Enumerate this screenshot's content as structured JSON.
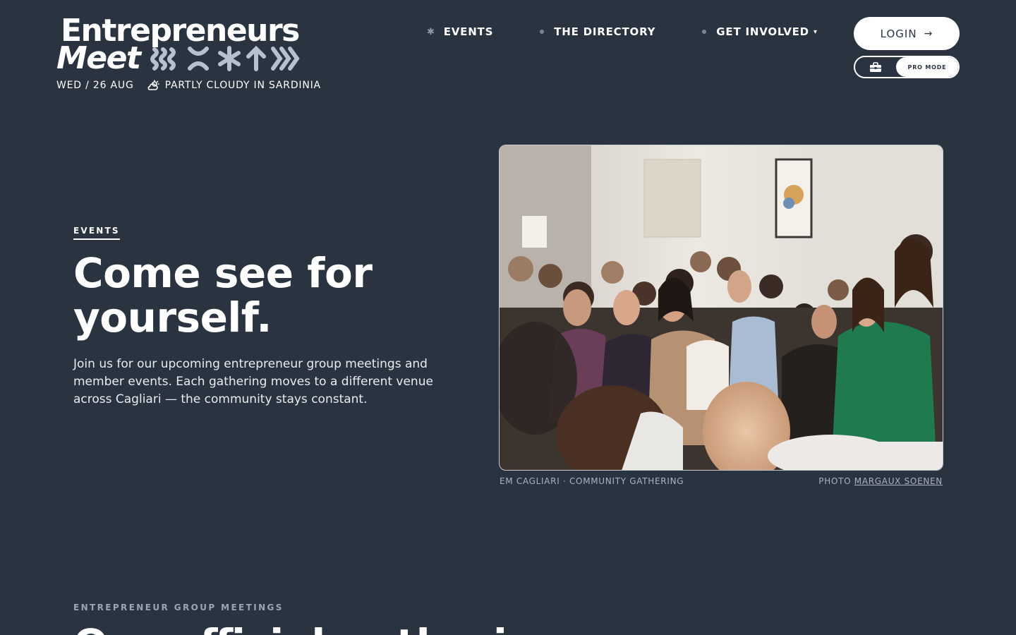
{
  "brand": {
    "line1": "Entrepreneurs",
    "line2": "Meet"
  },
  "meta": {
    "date": "WED / 26 AUG",
    "weather": "PARTLY CLOUDY IN SARDINIA"
  },
  "nav": {
    "events": "EVENTS",
    "directory": "THE DIRECTORY",
    "get_involved": "GET INVOLVED"
  },
  "login": {
    "label": "LOGIN"
  },
  "pro_mode": {
    "label": "PRO MODE"
  },
  "hero": {
    "eyebrow": "EVENTS",
    "title": "Come see for yourself.",
    "description": "Join us for our upcoming entrepreneur group meetings and member events. Each gathering moves to a different venue across Cagliari — the community stays constant.",
    "caption": "EM CAGLIARI · COMMUNITY GATHERING",
    "photo_credit_prefix": "PHOTO",
    "photo_credit_name": "MARGAUX SOENEN"
  },
  "next_section": {
    "eyebrow": "ENTREPRENEUR GROUP MEETINGS",
    "title": "Our official gatherings"
  },
  "icons": {
    "nav_bullet": "asterisk-icon",
    "weather": "partly-cloudy-icon",
    "login_arrow": "arrow-right-icon",
    "pro_mode": "briefcase-icon",
    "dropdown": "chevron-down-icon"
  },
  "colors": {
    "background": "#2a3340",
    "text": "#ffffff",
    "muted": "#9aa6b4"
  }
}
